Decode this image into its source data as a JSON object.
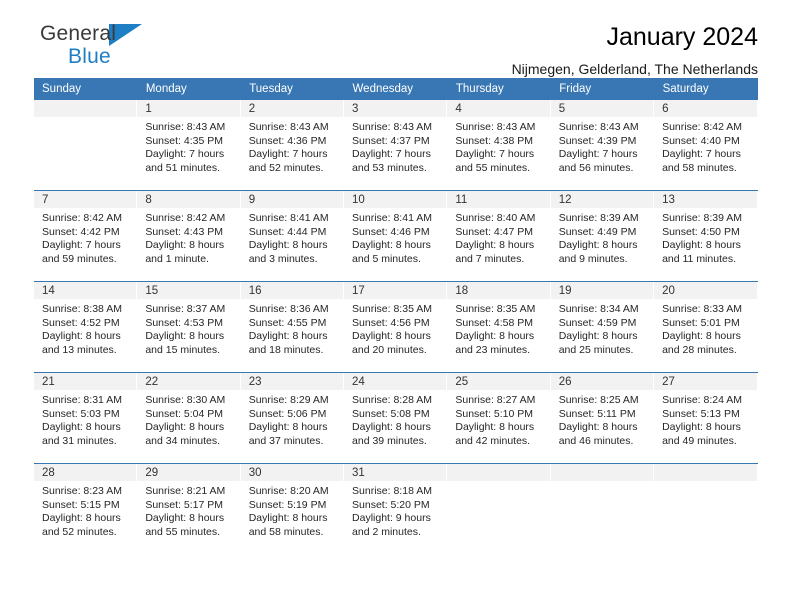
{
  "brand": {
    "name_top": "General",
    "name_bottom": "Blue",
    "accent_color": "#1f7fc4"
  },
  "header": {
    "title": "January 2024",
    "location": "Nijmegen, Gelderland, The Netherlands"
  },
  "theme": {
    "header_band": "#3877b4",
    "daynum_band": "#f2f2f2",
    "text": "#262626"
  },
  "weekday_headers": [
    "Sunday",
    "Monday",
    "Tuesday",
    "Wednesday",
    "Thursday",
    "Friday",
    "Saturday"
  ],
  "weeks": [
    {
      "days": [
        {
          "num": "",
          "sunrise": "",
          "sunset": "",
          "daylight_line1": "",
          "daylight_line2": "",
          "empty": true
        },
        {
          "num": "1",
          "sunrise": "Sunrise: 8:43 AM",
          "sunset": "Sunset: 4:35 PM",
          "daylight_line1": "Daylight: 7 hours",
          "daylight_line2": "and 51 minutes."
        },
        {
          "num": "2",
          "sunrise": "Sunrise: 8:43 AM",
          "sunset": "Sunset: 4:36 PM",
          "daylight_line1": "Daylight: 7 hours",
          "daylight_line2": "and 52 minutes."
        },
        {
          "num": "3",
          "sunrise": "Sunrise: 8:43 AM",
          "sunset": "Sunset: 4:37 PM",
          "daylight_line1": "Daylight: 7 hours",
          "daylight_line2": "and 53 minutes."
        },
        {
          "num": "4",
          "sunrise": "Sunrise: 8:43 AM",
          "sunset": "Sunset: 4:38 PM",
          "daylight_line1": "Daylight: 7 hours",
          "daylight_line2": "and 55 minutes."
        },
        {
          "num": "5",
          "sunrise": "Sunrise: 8:43 AM",
          "sunset": "Sunset: 4:39 PM",
          "daylight_line1": "Daylight: 7 hours",
          "daylight_line2": "and 56 minutes."
        },
        {
          "num": "6",
          "sunrise": "Sunrise: 8:42 AM",
          "sunset": "Sunset: 4:40 PM",
          "daylight_line1": "Daylight: 7 hours",
          "daylight_line2": "and 58 minutes."
        }
      ]
    },
    {
      "days": [
        {
          "num": "7",
          "sunrise": "Sunrise: 8:42 AM",
          "sunset": "Sunset: 4:42 PM",
          "daylight_line1": "Daylight: 7 hours",
          "daylight_line2": "and 59 minutes."
        },
        {
          "num": "8",
          "sunrise": "Sunrise: 8:42 AM",
          "sunset": "Sunset: 4:43 PM",
          "daylight_line1": "Daylight: 8 hours",
          "daylight_line2": "and 1 minute."
        },
        {
          "num": "9",
          "sunrise": "Sunrise: 8:41 AM",
          "sunset": "Sunset: 4:44 PM",
          "daylight_line1": "Daylight: 8 hours",
          "daylight_line2": "and 3 minutes."
        },
        {
          "num": "10",
          "sunrise": "Sunrise: 8:41 AM",
          "sunset": "Sunset: 4:46 PM",
          "daylight_line1": "Daylight: 8 hours",
          "daylight_line2": "and 5 minutes."
        },
        {
          "num": "11",
          "sunrise": "Sunrise: 8:40 AM",
          "sunset": "Sunset: 4:47 PM",
          "daylight_line1": "Daylight: 8 hours",
          "daylight_line2": "and 7 minutes."
        },
        {
          "num": "12",
          "sunrise": "Sunrise: 8:39 AM",
          "sunset": "Sunset: 4:49 PM",
          "daylight_line1": "Daylight: 8 hours",
          "daylight_line2": "and 9 minutes."
        },
        {
          "num": "13",
          "sunrise": "Sunrise: 8:39 AM",
          "sunset": "Sunset: 4:50 PM",
          "daylight_line1": "Daylight: 8 hours",
          "daylight_line2": "and 11 minutes."
        }
      ]
    },
    {
      "days": [
        {
          "num": "14",
          "sunrise": "Sunrise: 8:38 AM",
          "sunset": "Sunset: 4:52 PM",
          "daylight_line1": "Daylight: 8 hours",
          "daylight_line2": "and 13 minutes."
        },
        {
          "num": "15",
          "sunrise": "Sunrise: 8:37 AM",
          "sunset": "Sunset: 4:53 PM",
          "daylight_line1": "Daylight: 8 hours",
          "daylight_line2": "and 15 minutes."
        },
        {
          "num": "16",
          "sunrise": "Sunrise: 8:36 AM",
          "sunset": "Sunset: 4:55 PM",
          "daylight_line1": "Daylight: 8 hours",
          "daylight_line2": "and 18 minutes."
        },
        {
          "num": "17",
          "sunrise": "Sunrise: 8:35 AM",
          "sunset": "Sunset: 4:56 PM",
          "daylight_line1": "Daylight: 8 hours",
          "daylight_line2": "and 20 minutes."
        },
        {
          "num": "18",
          "sunrise": "Sunrise: 8:35 AM",
          "sunset": "Sunset: 4:58 PM",
          "daylight_line1": "Daylight: 8 hours",
          "daylight_line2": "and 23 minutes."
        },
        {
          "num": "19",
          "sunrise": "Sunrise: 8:34 AM",
          "sunset": "Sunset: 4:59 PM",
          "daylight_line1": "Daylight: 8 hours",
          "daylight_line2": "and 25 minutes."
        },
        {
          "num": "20",
          "sunrise": "Sunrise: 8:33 AM",
          "sunset": "Sunset: 5:01 PM",
          "daylight_line1": "Daylight: 8 hours",
          "daylight_line2": "and 28 minutes."
        }
      ]
    },
    {
      "days": [
        {
          "num": "21",
          "sunrise": "Sunrise: 8:31 AM",
          "sunset": "Sunset: 5:03 PM",
          "daylight_line1": "Daylight: 8 hours",
          "daylight_line2": "and 31 minutes."
        },
        {
          "num": "22",
          "sunrise": "Sunrise: 8:30 AM",
          "sunset": "Sunset: 5:04 PM",
          "daylight_line1": "Daylight: 8 hours",
          "daylight_line2": "and 34 minutes."
        },
        {
          "num": "23",
          "sunrise": "Sunrise: 8:29 AM",
          "sunset": "Sunset: 5:06 PM",
          "daylight_line1": "Daylight: 8 hours",
          "daylight_line2": "and 37 minutes."
        },
        {
          "num": "24",
          "sunrise": "Sunrise: 8:28 AM",
          "sunset": "Sunset: 5:08 PM",
          "daylight_line1": "Daylight: 8 hours",
          "daylight_line2": "and 39 minutes."
        },
        {
          "num": "25",
          "sunrise": "Sunrise: 8:27 AM",
          "sunset": "Sunset: 5:10 PM",
          "daylight_line1": "Daylight: 8 hours",
          "daylight_line2": "and 42 minutes."
        },
        {
          "num": "26",
          "sunrise": "Sunrise: 8:25 AM",
          "sunset": "Sunset: 5:11 PM",
          "daylight_line1": "Daylight: 8 hours",
          "daylight_line2": "and 46 minutes."
        },
        {
          "num": "27",
          "sunrise": "Sunrise: 8:24 AM",
          "sunset": "Sunset: 5:13 PM",
          "daylight_line1": "Daylight: 8 hours",
          "daylight_line2": "and 49 minutes."
        }
      ]
    },
    {
      "days": [
        {
          "num": "28",
          "sunrise": "Sunrise: 8:23 AM",
          "sunset": "Sunset: 5:15 PM",
          "daylight_line1": "Daylight: 8 hours",
          "daylight_line2": "and 52 minutes."
        },
        {
          "num": "29",
          "sunrise": "Sunrise: 8:21 AM",
          "sunset": "Sunset: 5:17 PM",
          "daylight_line1": "Daylight: 8 hours",
          "daylight_line2": "and 55 minutes."
        },
        {
          "num": "30",
          "sunrise": "Sunrise: 8:20 AM",
          "sunset": "Sunset: 5:19 PM",
          "daylight_line1": "Daylight: 8 hours",
          "daylight_line2": "and 58 minutes."
        },
        {
          "num": "31",
          "sunrise": "Sunrise: 8:18 AM",
          "sunset": "Sunset: 5:20 PM",
          "daylight_line1": "Daylight: 9 hours",
          "daylight_line2": "and 2 minutes."
        },
        {
          "num": "",
          "sunrise": "",
          "sunset": "",
          "daylight_line1": "",
          "daylight_line2": "",
          "empty": true
        },
        {
          "num": "",
          "sunrise": "",
          "sunset": "",
          "daylight_line1": "",
          "daylight_line2": "",
          "empty": true
        },
        {
          "num": "",
          "sunrise": "",
          "sunset": "",
          "daylight_line1": "",
          "daylight_line2": "",
          "empty": true
        }
      ]
    }
  ]
}
